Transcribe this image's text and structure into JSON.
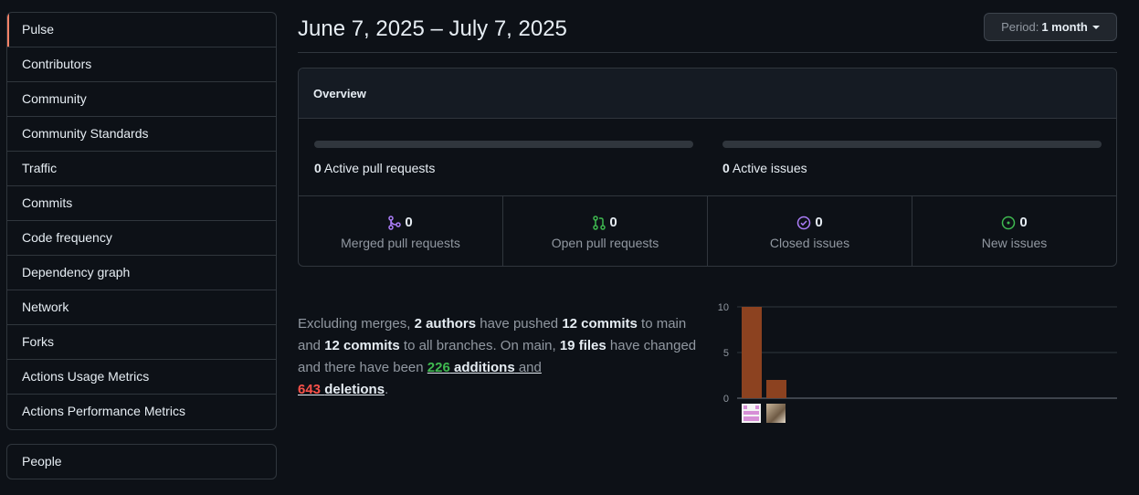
{
  "sidebar": {
    "items": [
      {
        "label": "Pulse"
      },
      {
        "label": "Contributors"
      },
      {
        "label": "Community"
      },
      {
        "label": "Community Standards"
      },
      {
        "label": "Traffic"
      },
      {
        "label": "Commits"
      },
      {
        "label": "Code frequency"
      },
      {
        "label": "Dependency graph"
      },
      {
        "label": "Network"
      },
      {
        "label": "Forks"
      },
      {
        "label": "Actions Usage Metrics"
      },
      {
        "label": "Actions Performance Metrics"
      }
    ],
    "people_label": "People"
  },
  "header": {
    "date_range": "June 7, 2025 – July 7, 2025",
    "period_prefix": "Period:",
    "period_value": "1 month"
  },
  "overview": {
    "title": "Overview",
    "active_prs_count": "0",
    "active_prs_label": "Active pull requests",
    "active_issues_count": "0",
    "active_issues_label": "Active issues",
    "cells": [
      {
        "count": "0",
        "label": "Merged pull requests",
        "icon": "merge-icon"
      },
      {
        "count": "0",
        "label": "Open pull requests",
        "icon": "pull-request-icon"
      },
      {
        "count": "0",
        "label": "Closed issues",
        "icon": "issue-closed-icon"
      },
      {
        "count": "0",
        "label": "New issues",
        "icon": "issue-open-icon"
      }
    ]
  },
  "summary": {
    "t1": "Excluding merges, ",
    "authors": "2 authors",
    "t2": " have pushed ",
    "commits_main": "12 commits",
    "t3": " to main and ",
    "commits_all": "12 commits",
    "t4": " to all branches. On main, ",
    "files": "19 files",
    "t5": " have changed and there have been ",
    "additions_num": "226",
    "additions_word": "additions",
    "t6": " and",
    "deletions_num": "643",
    "deletions_word": "deletions",
    "t7": "."
  },
  "colors": {
    "accent_selected": "#f78166",
    "bar": "#8c4220",
    "merged": "#ab7df8",
    "open": "#3fb950",
    "additions": "#3fb950",
    "deletions": "#f85149"
  },
  "chart_data": {
    "type": "bar",
    "categories": [
      "author-1",
      "author-2"
    ],
    "values": [
      10,
      2
    ],
    "ylim": [
      0,
      10
    ],
    "yticks": [
      0,
      5,
      10
    ]
  }
}
